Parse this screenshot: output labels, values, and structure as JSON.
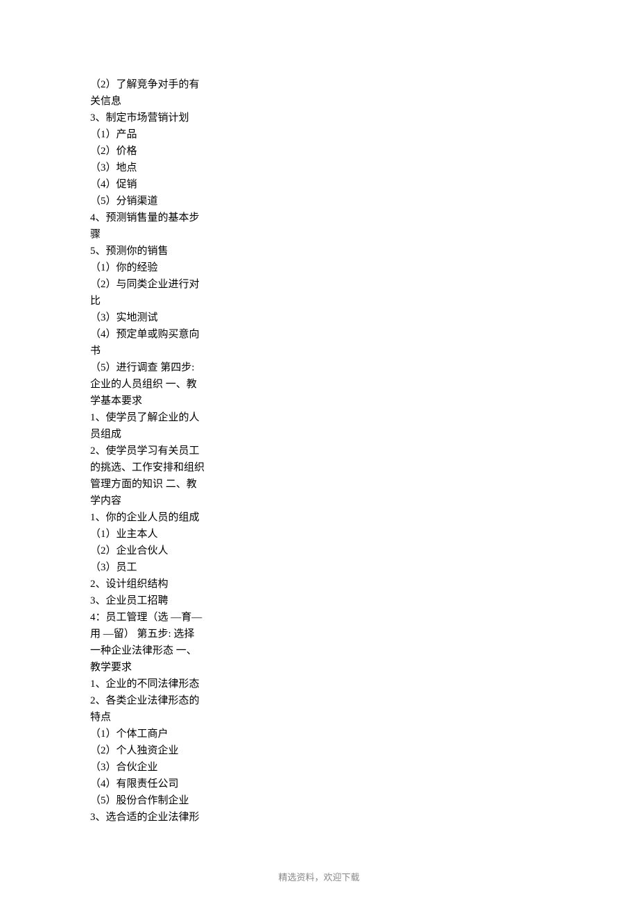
{
  "lines": [
    "（2）了解竞争对手的有",
    "关信息",
    "3、制定市场营销计划",
    "（1）产品",
    "（2）价格",
    "（3）地点",
    "（4）促销",
    "（5）分销渠道",
    "4、预测销售量的基本步",
    "骤",
    "5、预测你的销售",
    "（1）你的经验",
    "（2）与同类企业进行对",
    "比",
    "（3）实地测试",
    "（4）预定单或购买意向",
    "书",
    "（5）进行调查 第四步:",
    "企业的人员组织 一、教",
    "学基本要求",
    "1、使学员了解企业的人",
    "员组成",
    "2、使学员学习有关员工",
    "的挑选、工作安排和组织",
    "管理方面的知识 二、教",
    "学内容",
    "1、你的企业人员的组成",
    "（1）业主本人",
    "（2）企业合伙人",
    "（3）员工",
    "2、设计组织结构",
    "3、企业员工招聘",
    "4：员工管理（选 —育—",
    "用 —留）  第五步: 选择",
    "一种企业法律形态 一、",
    "教学要求",
    "1、企业的不同法律形态",
    "2、各类企业法律形态的",
    "特点",
    "（1）个体工商户",
    "（2）个人独资企业",
    "（3）合伙企业",
    "（4）有限责任公司",
    "（5）股份合作制企业",
    "3、选合适的企业法律形"
  ],
  "footer": "精选资料，欢迎下载"
}
